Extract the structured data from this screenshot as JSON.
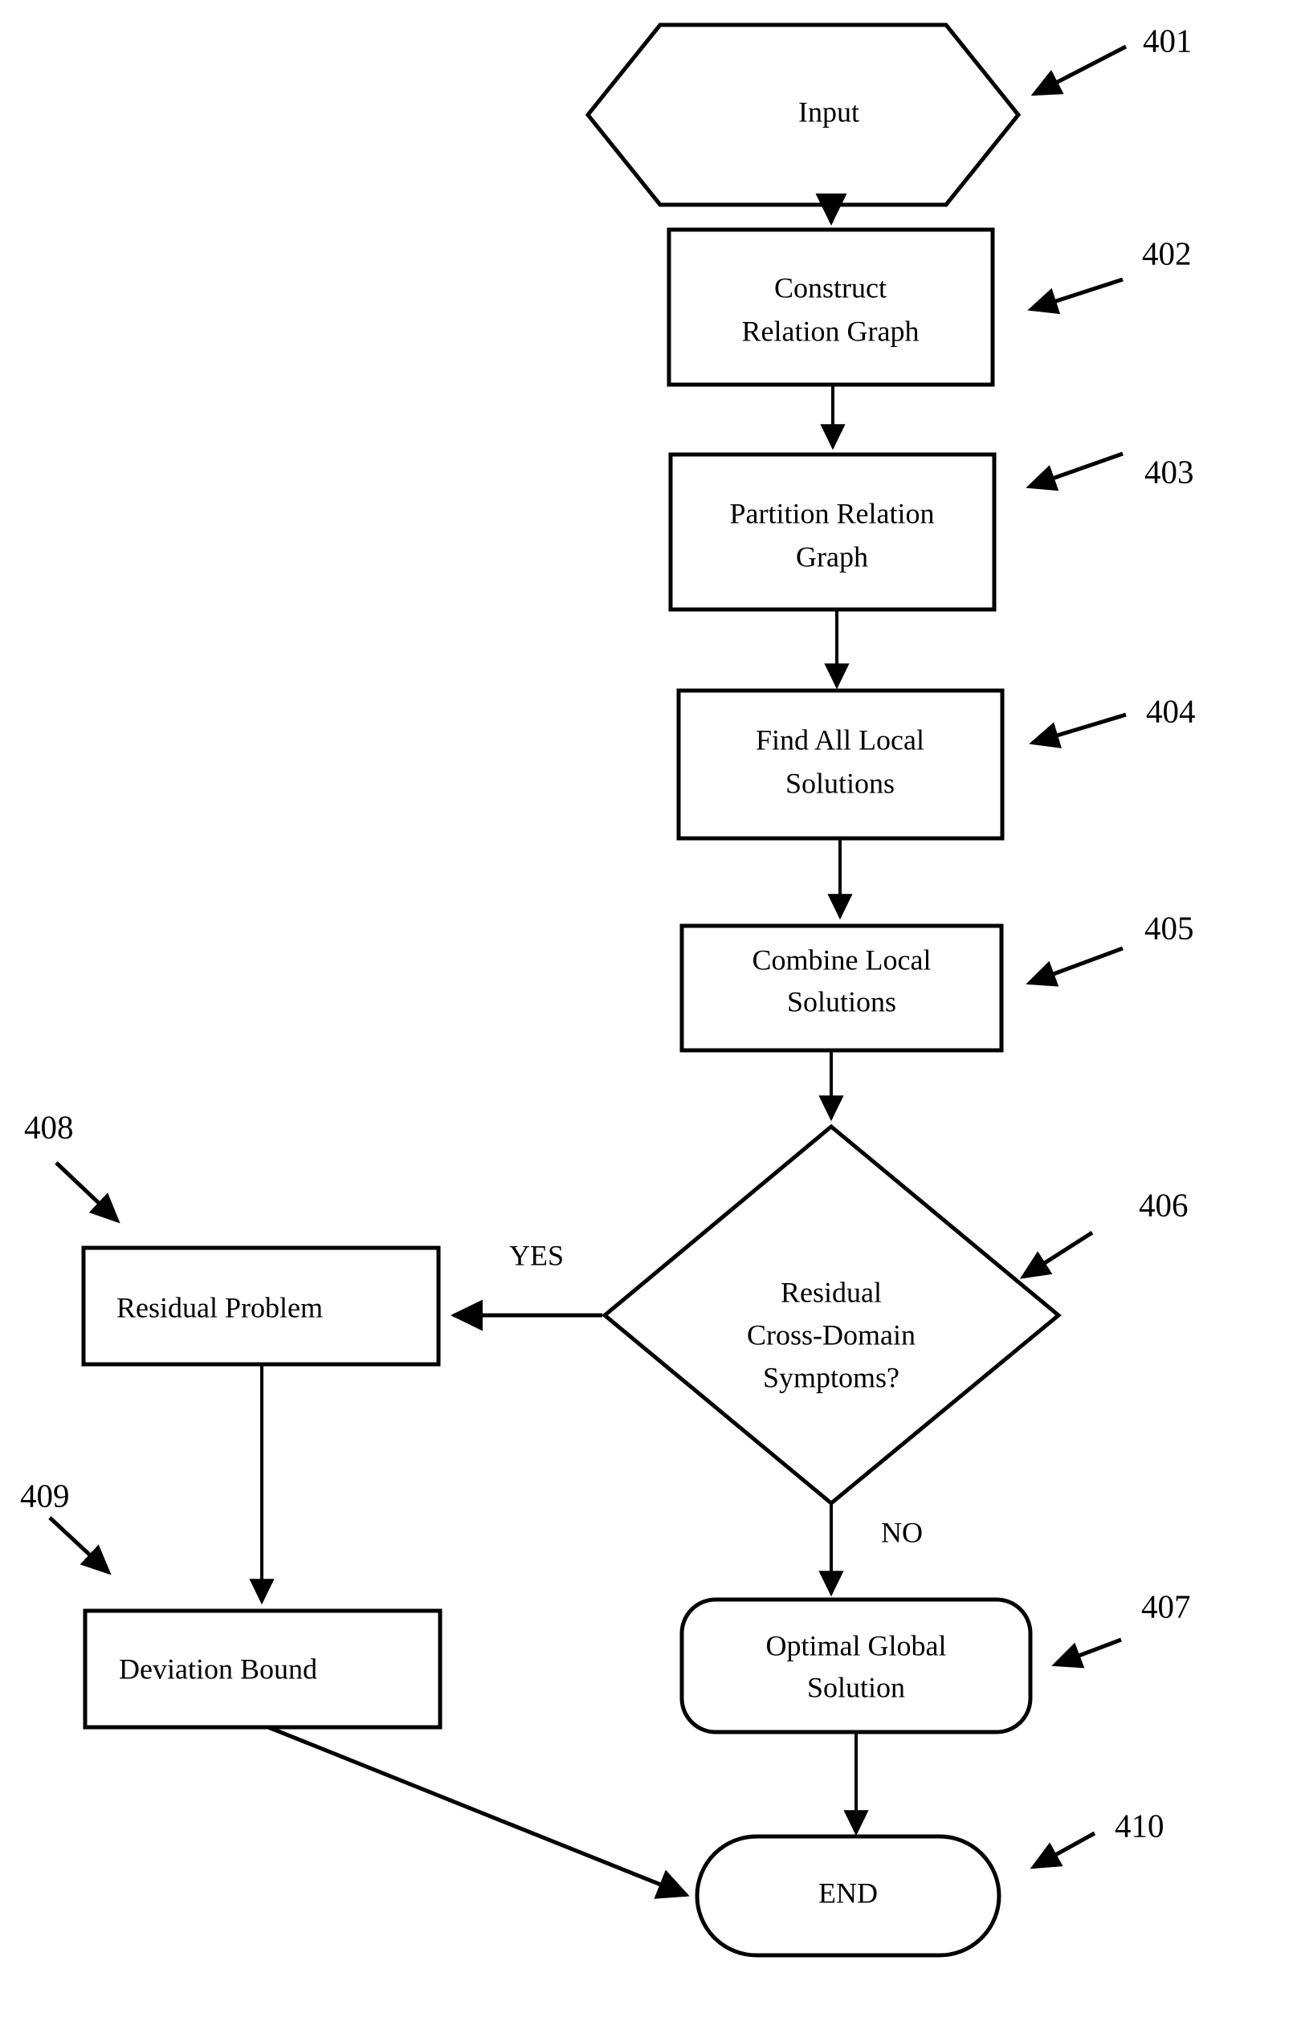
{
  "figure": {
    "type": "flowchart",
    "title": "",
    "background_color": "#ffffff",
    "line_color": "#000000"
  },
  "nodes": [
    {
      "ref": "401",
      "shape": "hexagon",
      "lines": [
        "Input"
      ],
      "text": "Input"
    },
    {
      "ref": "402",
      "shape": "rectangle",
      "lines": [
        "Construct",
        "Relation Graph"
      ],
      "line1": "Construct",
      "line2": "Relation Graph"
    },
    {
      "ref": "403",
      "shape": "rectangle",
      "lines": [
        "Partition Relation",
        "Graph"
      ],
      "line1": "Partition Relation",
      "line2": "Graph"
    },
    {
      "ref": "404",
      "shape": "rectangle",
      "lines": [
        "Find All Local",
        "Solutions"
      ],
      "line1": "Find All Local",
      "line2": "Solutions"
    },
    {
      "ref": "405",
      "shape": "rectangle",
      "lines": [
        "Combine Local",
        "Solutions"
      ],
      "line1": "Combine Local",
      "line2": "Solutions"
    },
    {
      "ref": "406",
      "shape": "diamond",
      "lines": [
        "Residual",
        "Cross-Domain",
        "Symptoms?"
      ],
      "line1": "Residual",
      "line2": "Cross-Domain",
      "line3": "Symptoms?"
    },
    {
      "ref": "407",
      "shape": "rounded-rectangle",
      "lines": [
        "Optimal Global",
        "Solution"
      ],
      "line1": "Optimal Global",
      "line2": "Solution"
    },
    {
      "ref": "408",
      "shape": "rectangle",
      "lines": [
        "Residual Problem"
      ],
      "text": "Residual Problem"
    },
    {
      "ref": "409",
      "shape": "rectangle",
      "lines": [
        "Deviation Bound"
      ],
      "text": "Deviation Bound"
    },
    {
      "ref": "410",
      "shape": "stadium",
      "lines": [
        "END"
      ],
      "text": "END"
    }
  ],
  "reference_labels": {
    "n401": "401",
    "n402": "402",
    "n403": "403",
    "n404": "404",
    "n405": "405",
    "n406": "406",
    "n407": "407",
    "n408": "408",
    "n409": "409",
    "n410": "410"
  },
  "edge_labels": {
    "yes": "YES",
    "no": "NO"
  },
  "edges": [
    {
      "from": "401",
      "to": "402",
      "label": ""
    },
    {
      "from": "402",
      "to": "403",
      "label": ""
    },
    {
      "from": "403",
      "to": "404",
      "label": ""
    },
    {
      "from": "404",
      "to": "405",
      "label": ""
    },
    {
      "from": "405",
      "to": "406",
      "label": ""
    },
    {
      "from": "406",
      "to": "408",
      "label": "YES"
    },
    {
      "from": "406",
      "to": "407",
      "label": "NO"
    },
    {
      "from": "408",
      "to": "409",
      "label": ""
    },
    {
      "from": "409",
      "to": "410",
      "label": ""
    },
    {
      "from": "407",
      "to": "410",
      "label": ""
    }
  ]
}
